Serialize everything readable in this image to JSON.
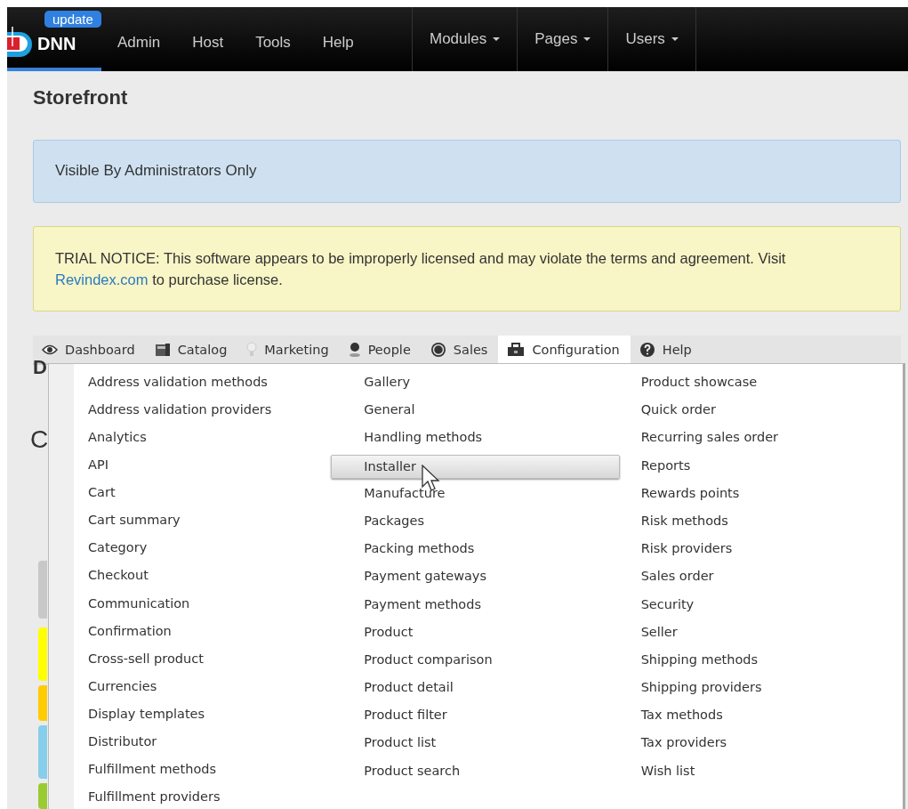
{
  "topbar": {
    "badge": "update",
    "logo": "DNN",
    "menu": [
      "Admin",
      "Host",
      "Tools",
      "Help"
    ],
    "dropdowns": [
      "Modules",
      "Pages",
      "Users"
    ]
  },
  "page_title": "Storefront",
  "admin_notice": "Visible By Administrators Only",
  "trial_notice": {
    "text": "TRIAL NOTICE: This software appears to be improperly licensed and may violate the terms and agreement. Visit",
    "link": "Revindex.com",
    "after": "to purchase license."
  },
  "tabs": [
    {
      "label": "Dashboard",
      "selected": false
    },
    {
      "label": "Catalog",
      "selected": false
    },
    {
      "label": "Marketing",
      "selected": false
    },
    {
      "label": "People",
      "selected": false
    },
    {
      "label": "Sales",
      "selected": false
    },
    {
      "label": "Configuration",
      "selected": true
    },
    {
      "label": "Help",
      "selected": false
    }
  ],
  "behind": {
    "heading_1": "D",
    "heading_2": "C",
    "tiles": [
      {
        "color": "#c8c8c8"
      },
      {
        "color": "#ffff00"
      },
      {
        "color": "#ffcc00"
      },
      {
        "color": "#87ceeb"
      },
      {
        "color": "#99cc33"
      }
    ]
  },
  "menu_columns": [
    [
      {
        "label": "Address validation methods",
        "selected": false
      },
      {
        "label": "Address validation providers",
        "selected": false
      },
      {
        "label": "Analytics",
        "selected": false
      },
      {
        "label": "API",
        "selected": false
      },
      {
        "label": "Cart",
        "selected": false
      },
      {
        "label": "Cart summary",
        "selected": false
      },
      {
        "label": "Category",
        "selected": false
      },
      {
        "label": "Checkout",
        "selected": false
      },
      {
        "label": "Communication",
        "selected": false
      },
      {
        "label": "Confirmation",
        "selected": false
      },
      {
        "label": "Cross-sell product",
        "selected": false
      },
      {
        "label": "Currencies",
        "selected": false
      },
      {
        "label": "Display templates",
        "selected": false
      },
      {
        "label": "Distributor",
        "selected": false
      },
      {
        "label": "Fulfillment methods",
        "selected": false
      },
      {
        "label": "Fulfillment providers",
        "selected": false
      }
    ],
    [
      {
        "label": "Gallery",
        "selected": false
      },
      {
        "label": "General",
        "selected": false
      },
      {
        "label": "Handling methods",
        "selected": false
      },
      {
        "label": "Installer",
        "selected": true
      },
      {
        "label": "Manufacture",
        "selected": false
      },
      {
        "label": "Packages",
        "selected": false
      },
      {
        "label": "Packing methods",
        "selected": false
      },
      {
        "label": "Payment gateways",
        "selected": false
      },
      {
        "label": "Payment methods",
        "selected": false
      },
      {
        "label": "Product",
        "selected": false
      },
      {
        "label": "Product comparison",
        "selected": false
      },
      {
        "label": "Product detail",
        "selected": false
      },
      {
        "label": "Product filter",
        "selected": false
      },
      {
        "label": "Product list",
        "selected": false
      },
      {
        "label": "Product search",
        "selected": false
      }
    ],
    [
      {
        "label": "Product showcase",
        "selected": false
      },
      {
        "label": "Quick order",
        "selected": false
      },
      {
        "label": "Recurring sales order",
        "selected": false
      },
      {
        "label": "Reports",
        "selected": false
      },
      {
        "label": "Rewards points",
        "selected": false
      },
      {
        "label": "Risk methods",
        "selected": false
      },
      {
        "label": "Risk providers",
        "selected": false
      },
      {
        "label": "Sales order",
        "selected": false
      },
      {
        "label": "Security",
        "selected": false
      },
      {
        "label": "Seller",
        "selected": false
      },
      {
        "label": "Shipping methods",
        "selected": false
      },
      {
        "label": "Shipping providers",
        "selected": false
      },
      {
        "label": "Tax methods",
        "selected": false
      },
      {
        "label": "Tax providers",
        "selected": false
      },
      {
        "label": "Wish list",
        "selected": false
      }
    ]
  ]
}
